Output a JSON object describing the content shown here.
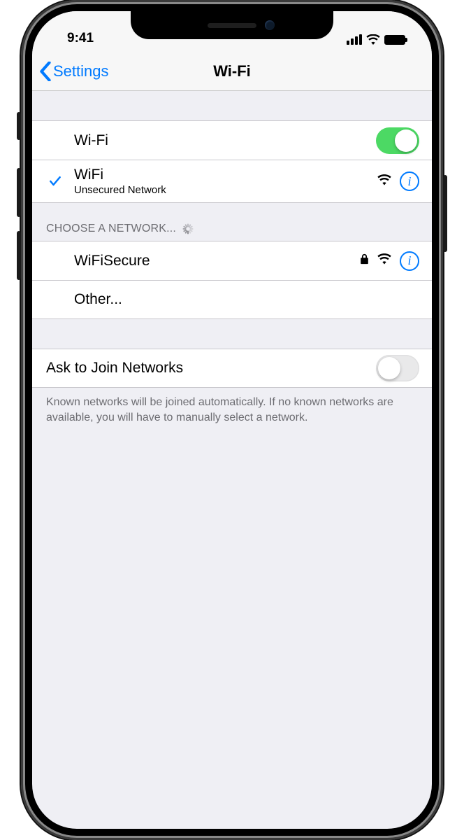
{
  "status": {
    "time": "9:41"
  },
  "nav": {
    "back_label": "Settings",
    "title": "Wi-Fi"
  },
  "wifi_toggle": {
    "label": "Wi-Fi",
    "on": true
  },
  "connected_network": {
    "name": "WiFi",
    "subtitle": "Unsecured Network",
    "secured": false
  },
  "choose_header": "CHOOSE A NETWORK...",
  "networks": [
    {
      "name": "WiFiSecure",
      "secured": true
    }
  ],
  "other_label": "Other...",
  "ask_join": {
    "label": "Ask to Join Networks",
    "on": false
  },
  "footer": "Known networks will be joined automatically. If no known networks are available, you will have to manually select a network."
}
